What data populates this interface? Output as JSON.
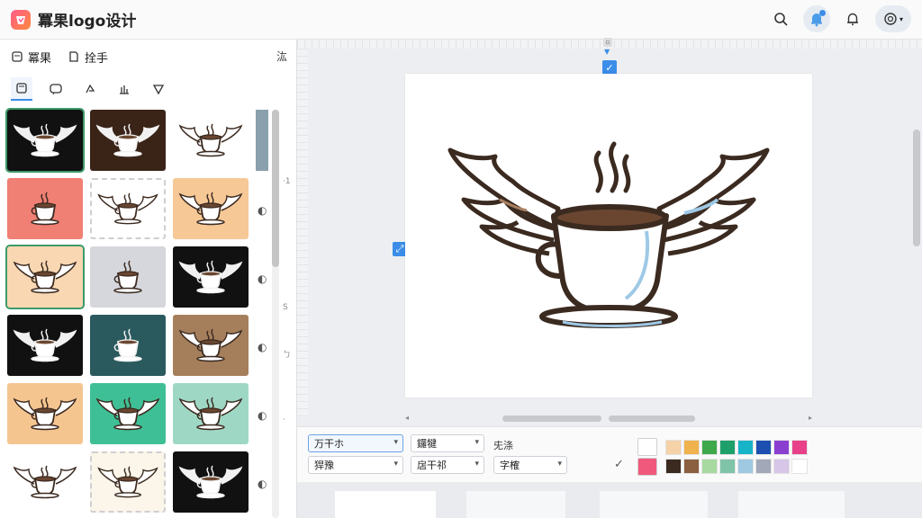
{
  "app": {
    "title": "冪果logo设计"
  },
  "left_panel": {
    "tab1": "冪果",
    "tab2": "拴手",
    "collapse": "汯",
    "side_marks": [
      "·1",
      "S",
      "ㄅ",
      "·"
    ]
  },
  "thumbnails": [
    {
      "bg": "#111111",
      "cup": "#ffffff",
      "wing": "#f1f1f1",
      "selected": true
    },
    {
      "bg": "#3a2418",
      "cup": "#ffffff",
      "wing": "#f1f1f1"
    },
    {
      "bg": "#ffffff",
      "cup": "#ffffff",
      "wing": "#ffffff"
    },
    {
      "bg": "#f07f74",
      "cup": "#ffffff",
      "wing": "#ffffff",
      "no_wings": true
    },
    {
      "bg": "#ffffff",
      "cup": "#ffffff",
      "wing": "#ffffff",
      "dashed": true
    },
    {
      "bg": "#f6c896",
      "cup": "#ffffff",
      "wing": "#ffffff"
    },
    {
      "bg": "#f8d7b2",
      "cup": "#ffffff",
      "wing": "#ffffff",
      "selected": true
    },
    {
      "bg": "#d5d7dc",
      "cup": "#ffffff",
      "wing": "#ffffff",
      "no_wings": true
    },
    {
      "bg": "#111111",
      "cup": "#ffffff",
      "wing": "#f1f1f1"
    },
    {
      "bg": "#111111",
      "cup": "#ffffff",
      "wing": "#f1f1f1"
    },
    {
      "bg": "#2a5a5e",
      "cup": "#ffffff",
      "wing": "#ffffff",
      "no_wings": true
    },
    {
      "bg": "#a57f5c",
      "cup": "#ffffff",
      "wing": "#ffffff"
    },
    {
      "bg": "#f5c590",
      "cup": "#ffffff",
      "wing": "#ffffff"
    },
    {
      "bg": "#3fbf95",
      "cup": "#ffffff",
      "wing": "#ffffff"
    },
    {
      "bg": "#9ed8c5",
      "cup": "#ffffff",
      "wing": "#ffffff"
    },
    {
      "bg": "#ffffff",
      "cup": "#ffffff",
      "wing": "#ffffff"
    },
    {
      "bg": "#fbf5ea",
      "cup": "#ffffff",
      "wing": "#ffffff",
      "dashed": true
    },
    {
      "bg": "#111111",
      "cup": "#ffffff",
      "wing": "#f1f1f1"
    }
  ],
  "toolbar": {
    "select1": "万干ホ",
    "select2": "鑼犍",
    "label1": "兂涤",
    "select3": "猂豫",
    "select4": "扂干祁",
    "select5": "字榷"
  },
  "colors": {
    "accent": "#3b8de8",
    "selected_swatch": "#f0587c",
    "palette_row1": [
      "#f5d2a8",
      "#f0b24c",
      "#3ea84a",
      "#1f9f6a",
      "#17b4c8",
      "#1c4fb0",
      "#8b3fd0",
      "#e8418a"
    ],
    "palette_row2": [
      "#3b2a20",
      "#8a6040",
      "#a7d9a0",
      "#7fc4a8",
      "#9ec9e0",
      "#a2a8b8",
      "#d7c6e8",
      "#ffffff"
    ]
  }
}
